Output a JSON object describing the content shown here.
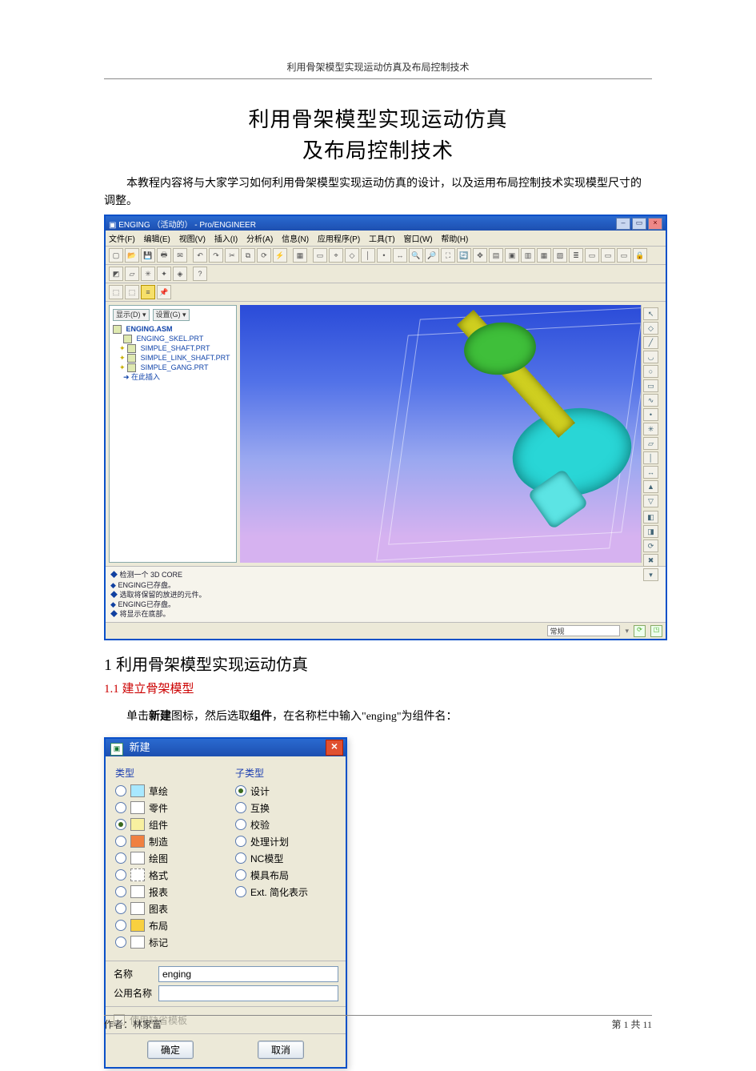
{
  "header": {
    "running": "利用骨架模型实现运动仿真及布局控制技术"
  },
  "title": {
    "line1": "利用骨架模型实现运动仿真",
    "line2": "及布局控制技术"
  },
  "intro": "本教程内容将与大家学习如何利用骨架模型实现运动仿真的设计，以及运用布局控制技术实现模型尺寸的调整。",
  "proe": {
    "title_text": "ENGING （活动的） - Pro/ENGINEER",
    "menu": [
      "文件(F)",
      "编辑(E)",
      "视图(V)",
      "插入(I)",
      "分析(A)",
      "信息(N)",
      "应用程序(P)",
      "工具(T)",
      "窗口(W)",
      "帮助(H)"
    ],
    "tree_dropdowns": [
      "显示(D) ▾",
      "设置(G) ▾"
    ],
    "tree_root": "ENGING.ASM",
    "tree_items": [
      "ENGING_SKEL.PRT",
      "SIMPLE_SHAFT.PRT",
      "SIMPLE_LINK_SHAFT.PRT",
      "SIMPLE_GANG.PRT"
    ],
    "tree_insert": "在此插入",
    "messages": [
      "检测一个 3D CORE",
      "ENGING已存盘。",
      "选取将保留的放进的元件。",
      "ENGING已存盘。",
      "将显示在底部。"
    ],
    "status_field": "常规"
  },
  "section1": {
    "heading": "1 利用骨架模型实现运动仿真"
  },
  "section11": {
    "heading": "1.1 建立骨架模型",
    "text_prefix": "单击",
    "bold_new": "新建",
    "text_mid1": "图标，然后选取",
    "bold_asm": "组件",
    "text_mid2": "，在名称栏中输入\"enging\"为组件名："
  },
  "dialog": {
    "title": "新建",
    "type_legend": "类型",
    "subtype_legend": "子类型",
    "types": [
      {
        "label": "草绘",
        "iconClass": "ic-sketch",
        "selected": false
      },
      {
        "label": "零件",
        "iconClass": "ic-part",
        "selected": false
      },
      {
        "label": "组件",
        "iconClass": "ic-asm",
        "selected": true
      },
      {
        "label": "制造",
        "iconClass": "ic-mfg",
        "selected": false
      },
      {
        "label": "绘图",
        "iconClass": "ic-drw",
        "selected": false
      },
      {
        "label": "格式",
        "iconClass": "ic-fmt",
        "selected": false
      },
      {
        "label": "报表",
        "iconClass": "ic-rpt",
        "selected": false
      },
      {
        "label": "图表",
        "iconClass": "ic-dgm",
        "selected": false
      },
      {
        "label": "布局",
        "iconClass": "ic-lay",
        "selected": false
      },
      {
        "label": "标记",
        "iconClass": "ic-mrk",
        "selected": false
      }
    ],
    "subtypes": [
      {
        "label": "设计",
        "selected": true
      },
      {
        "label": "互换",
        "selected": false
      },
      {
        "label": "校验",
        "selected": false
      },
      {
        "label": "处理计划",
        "selected": false
      },
      {
        "label": "NC模型",
        "selected": false
      },
      {
        "label": "模具布局",
        "selected": false
      },
      {
        "label": "Ext. 简化表示",
        "selected": false
      }
    ],
    "name_label": "名称",
    "common_name_label": "公用名称",
    "name_value": "enging",
    "use_default_template": "使用缺省模板",
    "ok": "确定",
    "cancel": "取消"
  },
  "footer": {
    "author_label": "作者：林家富",
    "page_label": "第 1 共 11"
  }
}
